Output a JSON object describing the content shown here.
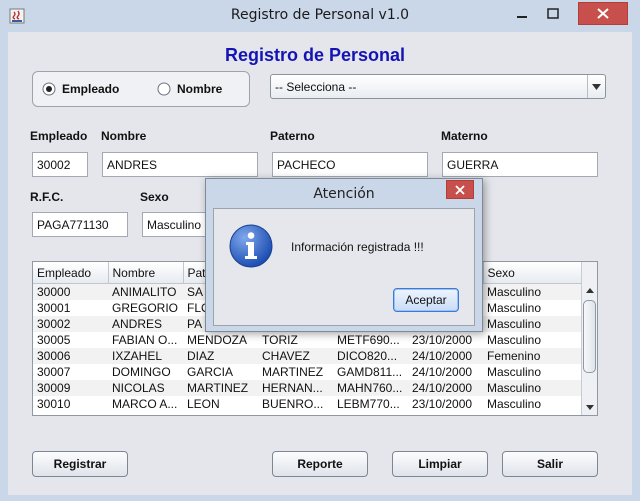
{
  "window": {
    "title": "Registro de Personal v1.0"
  },
  "form": {
    "heading": "Registro de Personal",
    "search_mode": {
      "options": [
        "Empleado",
        "Nombre"
      ],
      "selected": "Empleado"
    },
    "combo": {
      "value": "-- Selecciona --"
    },
    "labels": {
      "empleado": "Empleado",
      "nombre": "Nombre",
      "paterno": "Paterno",
      "materno": "Materno",
      "rfc": "R.F.C.",
      "sexo": "Sexo"
    },
    "values": {
      "empleado": "30002",
      "nombre": "ANDRES",
      "paterno": "PACHECO",
      "materno": "GUERRA",
      "rfc": "PAGA771130",
      "sexo": "Masculino"
    }
  },
  "table": {
    "headers": [
      "Empleado",
      "Nombre",
      "Pat",
      "",
      "",
      "",
      "Sexo"
    ],
    "rows": [
      [
        "30000",
        "ANIMALITO",
        "SA",
        "",
        "",
        "",
        "Masculino"
      ],
      [
        "30001",
        "GREGORIO",
        "FLO",
        "",
        "",
        "",
        "Masculino"
      ],
      [
        "30002",
        "ANDRES",
        "PA",
        "",
        "",
        "",
        "Masculino"
      ],
      [
        "30005",
        "FABIAN O...",
        "MENDOZA",
        "TORIZ",
        "METF690...",
        "23/10/2000",
        "Masculino"
      ],
      [
        "30006",
        "IXZAHEL",
        "DIAZ",
        "CHAVEZ",
        "DICO820...",
        "24/10/2000",
        "Femenino"
      ],
      [
        "30007",
        "DOMINGO",
        "GARCIA",
        "MARTINEZ",
        "GAMD811...",
        "24/10/2000",
        "Masculino"
      ],
      [
        "30009",
        "NICOLAS",
        "MARTINEZ",
        "HERNAN...",
        "MAHN760...",
        "24/10/2000",
        "Masculino"
      ],
      [
        "30010",
        "MARCO A...",
        "LEON",
        "BUENRO...",
        "LEBM770...",
        "23/10/2000",
        "Masculino"
      ]
    ]
  },
  "buttons": {
    "registrar": "Registrar",
    "reporte": "Reporte",
    "limpiar": "Limpiar",
    "salir": "Salir"
  },
  "dialog": {
    "title": "Atención",
    "message": "Información registrada !!!",
    "ok": "Aceptar",
    "icon": "info-icon"
  },
  "colors": {
    "heading": "#1414b4",
    "titlebar": "#c9d7e9",
    "close": "#c7504c",
    "info": "#2a62c4"
  }
}
